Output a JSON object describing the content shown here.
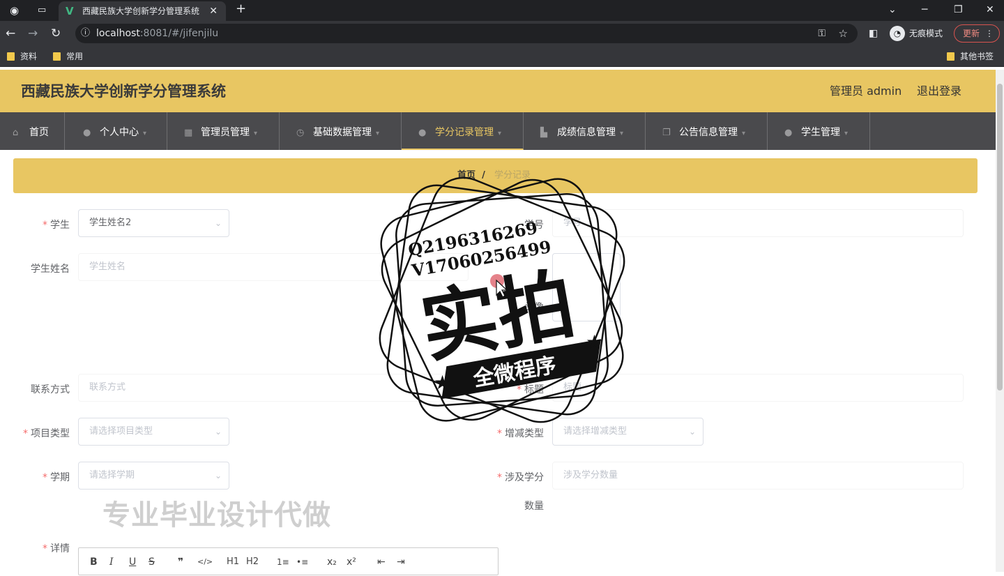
{
  "browser": {
    "tab_title": "西藏民族大学创新学分管理系统",
    "tab_close": "✕",
    "new_tab": "+",
    "url_host": "localhost",
    "url_rest": ":8081/#/jifenjilu",
    "incognito_label": "无痕模式",
    "update_label": "更新",
    "bookmarks": [
      "资料",
      "常用"
    ],
    "other_bookmarks": "其他书签"
  },
  "header": {
    "title": "西藏民族大学创新学分管理系统",
    "user": "管理员 admin",
    "logout": "退出登录"
  },
  "nav": {
    "items": [
      {
        "label": "首页",
        "icon": "home-icon"
      },
      {
        "label": "个人中心",
        "icon": "user-icon"
      },
      {
        "label": "管理员管理",
        "icon": "grid-icon"
      },
      {
        "label": "基础数据管理",
        "icon": "clock-icon"
      },
      {
        "label": "学分记录管理",
        "icon": "bulb-icon"
      },
      {
        "label": "成绩信息管理",
        "icon": "chart-icon"
      },
      {
        "label": "公告信息管理",
        "icon": "copy-icon"
      },
      {
        "label": "学生管理",
        "icon": "user-icon"
      }
    ],
    "active": "学分记录管理"
  },
  "breadcrumb": {
    "home": "首页",
    "sep": "/",
    "current": "学分记录"
  },
  "form": {
    "student_label": "学生",
    "student_value": "学生姓名2",
    "student_no_label": "学号",
    "student_no_placeholder": "学号",
    "student_name_label": "学生姓名",
    "student_name_placeholder": "学生姓名",
    "avatar_label": "头像",
    "contact_label": "联系方式",
    "contact_placeholder": "联系方式",
    "title_label": "标题",
    "title_placeholder": "标题",
    "project_type_label": "项目类型",
    "project_type_placeholder": "请选择项目类型",
    "change_type_label": "增减类型",
    "change_type_placeholder": "请选择增减类型",
    "term_label": "学期",
    "term_placeholder": "请选择学期",
    "credit_label": "涉及学分",
    "credit_label2": "数量",
    "credit_placeholder": "涉及学分数量",
    "detail_label": "详情"
  },
  "editor": {
    "tools": [
      "B",
      "I",
      "U",
      "S",
      "❞",
      "</>",
      "H1",
      "H2",
      "1≡",
      "•≡",
      "x₂",
      "x²",
      "⇤",
      "⇥"
    ]
  },
  "watermark": {
    "phone1": "Q2196316269",
    "phone2": "V17060256499",
    "big": "实拍",
    "banner": "全微程序",
    "bottom": "专业毕业设计代做"
  }
}
